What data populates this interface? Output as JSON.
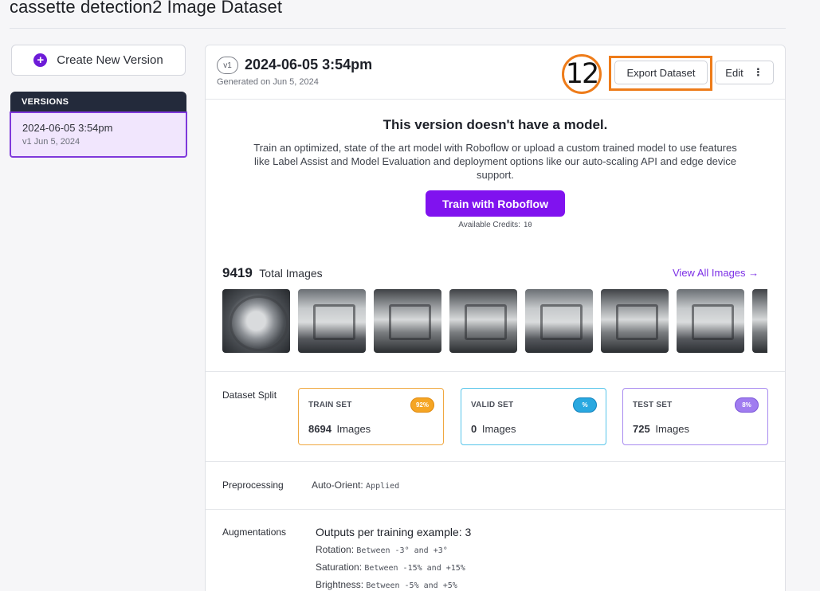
{
  "page": {
    "title": "cassette detection2 Image Dataset"
  },
  "sidebar": {
    "create_label": "Create New Version",
    "versions_header": "VERSIONS",
    "versions": [
      {
        "name": "2024-06-05 3:54pm",
        "sub": "v1 Jun 5, 2024"
      }
    ]
  },
  "version": {
    "badge": "v1",
    "title": "2024-06-05 3:54pm",
    "generated": "Generated on Jun 5, 2024",
    "step_marker": "12",
    "export_label": "Export Dataset",
    "edit_label": "Edit"
  },
  "no_model": {
    "heading": "This version doesn't have a model.",
    "description": "Train an optimized, state of the art model with Roboflow or upload a custom trained model to use features like Label Assist and Model Evaluation and deployment options like our auto-scaling API and edge device support.",
    "train_label": "Train with Roboflow",
    "credits_label": "Available Credits:",
    "credits_value": "10"
  },
  "images": {
    "count": "9419",
    "count_label": "Total Images",
    "view_all_label": "View All Images →",
    "thumbnails": [
      "thumb-1",
      "thumb-2",
      "thumb-3",
      "thumb-4",
      "thumb-5",
      "thumb-6",
      "thumb-7",
      "thumb-8"
    ]
  },
  "split": {
    "label": "Dataset Split",
    "train": {
      "name": "TRAIN SET",
      "pct": "92%",
      "count": "8694",
      "unit": "Images"
    },
    "valid": {
      "name": "VALID SET",
      "pct": "%",
      "count": "0",
      "unit": "Images"
    },
    "test": {
      "name": "TEST SET",
      "pct": "8%",
      "count": "725",
      "unit": "Images"
    }
  },
  "preprocessing": {
    "label": "Preprocessing",
    "key": "Auto-Orient:",
    "value": "Applied"
  },
  "augmentations": {
    "label": "Augmentations",
    "outputs": "Outputs per training example: 3",
    "items": [
      {
        "key": "Rotation:",
        "value": "Between -3° and +3°"
      },
      {
        "key": "Saturation:",
        "value": "Between -15% and +15%"
      },
      {
        "key": "Brightness:",
        "value": "Between -5% and +5%"
      }
    ]
  },
  "colors": {
    "accent": "#8012ef",
    "highlight": "#ee7c1a",
    "train": "#f5a524",
    "valid": "#29a8e0",
    "test": "#a07cf0",
    "sidebar_header": "#232a3b"
  }
}
